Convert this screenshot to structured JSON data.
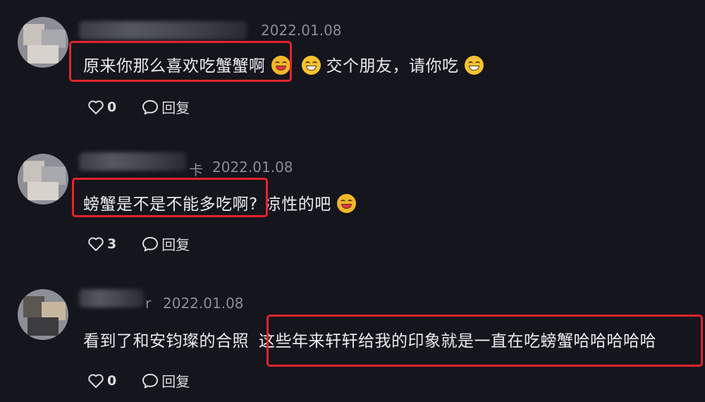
{
  "comments": [
    {
      "username_tail": "",
      "date": "2022.01.08",
      "text_before": "原来你那么喜欢吃蟹蟹啊",
      "text_after": "交个朋友，请你吃",
      "likes": "0",
      "reply_label": "回复"
    },
    {
      "username_tail": "卡",
      "date": "2022.01.08",
      "text_before": "螃蟹是不是不能多吃啊?",
      "text_after": "凉性的吧",
      "likes": "3",
      "reply_label": "回复"
    },
    {
      "username_tail": "r",
      "date": "2022.01.08",
      "text_before": "看到了和安钧璨的合照",
      "text_after": "这些年来轩轩给我的印象就是一直在吃螃蟹哈哈哈哈哈",
      "likes": "0",
      "reply_label": "回复"
    }
  ],
  "icons": [
    "heart-outline-icon",
    "comment-bubble-icon",
    "grin-emoji-icon"
  ],
  "colors": {
    "background": "#14151d",
    "highlight_box": "#e3242b",
    "emoji": "#f6c330",
    "meta_text": "#8b8c93"
  }
}
